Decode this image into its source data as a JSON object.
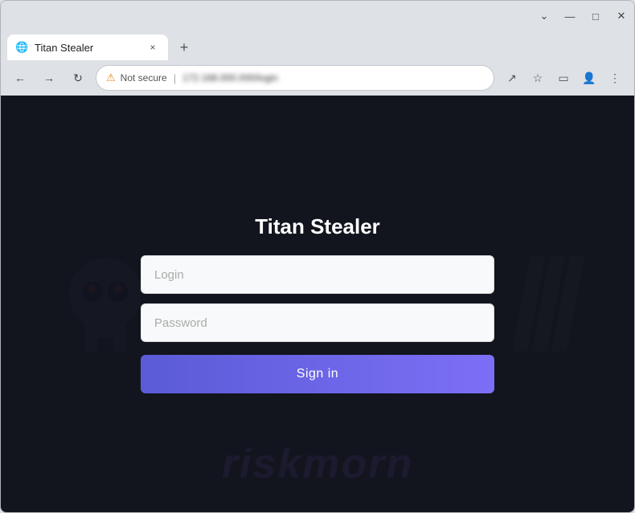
{
  "browser": {
    "title": "Titan Stealer",
    "tab": {
      "favicon_symbol": "🌐",
      "title": "Titan Stealer",
      "close_symbol": "×"
    },
    "new_tab_symbol": "+",
    "nav": {
      "back_symbol": "←",
      "forward_symbol": "→",
      "reload_symbol": "↻"
    },
    "address_bar": {
      "warning_symbol": "⚠",
      "not_secure": "Not secure",
      "separator": "|",
      "url": "172.168.000.000/login"
    },
    "toolbar_icons": {
      "share": "↗",
      "bookmark": "☆",
      "sidebar": "▭",
      "profile": "👤",
      "menu": "⋮"
    },
    "window_controls": {
      "minimize": "—",
      "maximize": "□",
      "close": "✕",
      "chevron": "⌄"
    }
  },
  "page": {
    "title": "Titan Stealer",
    "login_placeholder": "Login",
    "password_placeholder": "Password",
    "sign_in_label": "Sign in",
    "watermark_text": "riskmorn",
    "slash_text": "///"
  }
}
